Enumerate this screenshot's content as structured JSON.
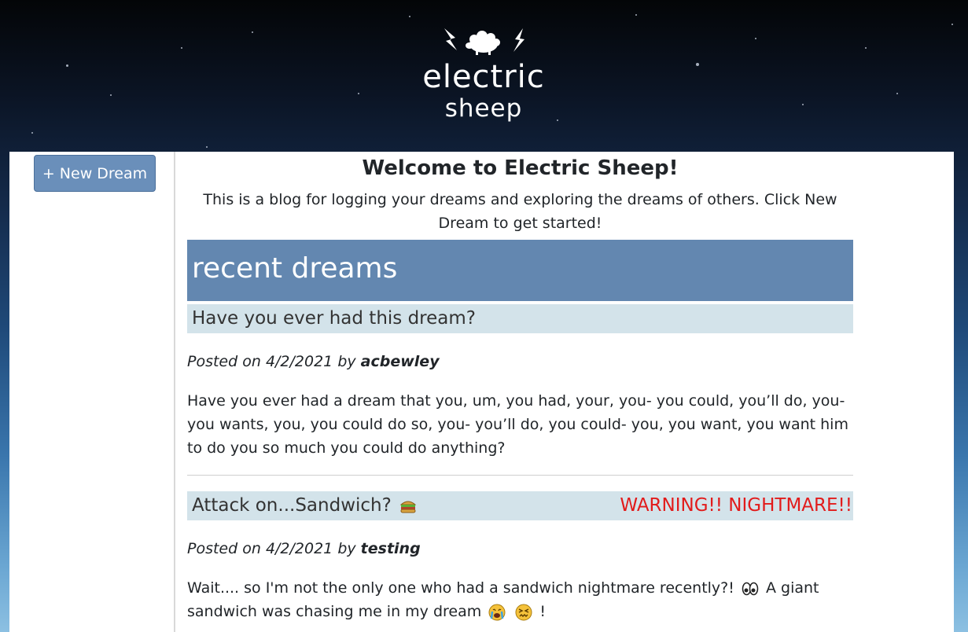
{
  "header": {
    "logo_line1": "electric",
    "logo_line2": "sheep"
  },
  "sidebar": {
    "new_dream_label": "+ New Dream"
  },
  "welcome": {
    "title": "Welcome to Electric Sheep!",
    "text": "This is a blog for logging your dreams and exploring the dreams of others. Click New Dream to get started!"
  },
  "recent": {
    "heading": "recent dreams"
  },
  "posts": [
    {
      "title": "Have you ever had this dream?",
      "posted_prefix": "Posted on ",
      "date": "4/2/2021",
      "by": " by ",
      "author": "acbewley",
      "body": "Have you ever had a dream that you, um, you had, your, you- you could, you’ll do, you- you wants, you, you could do so, you- you’ll do, you could- you, you want, you want him to do you so much you could do anything?"
    },
    {
      "title": "Attack on...Sandwich?",
      "warning": "WARNING!! NIGHTMARE!!",
      "posted_prefix": "Posted on ",
      "date": "4/2/2021",
      "by": " by ",
      "author": "testing",
      "body_part1": "Wait.... so I'm not the only one who had a sandwich nightmare recently?!",
      "body_part2": "A giant sandwich was chasing me in my dream",
      "body_part3": "!"
    }
  ],
  "icons": {
    "logo": "electric-sheep-logo",
    "sandwich": "sandwich-emoji",
    "eyes": "eyes-emoji",
    "crying": "crying-face-emoji",
    "confounded": "confounded-face-emoji"
  },
  "colors": {
    "accent": "#6387b0",
    "button": "#6a8fba",
    "post_title_bg": "#d3e3ea",
    "warning": "#e21b1b"
  }
}
